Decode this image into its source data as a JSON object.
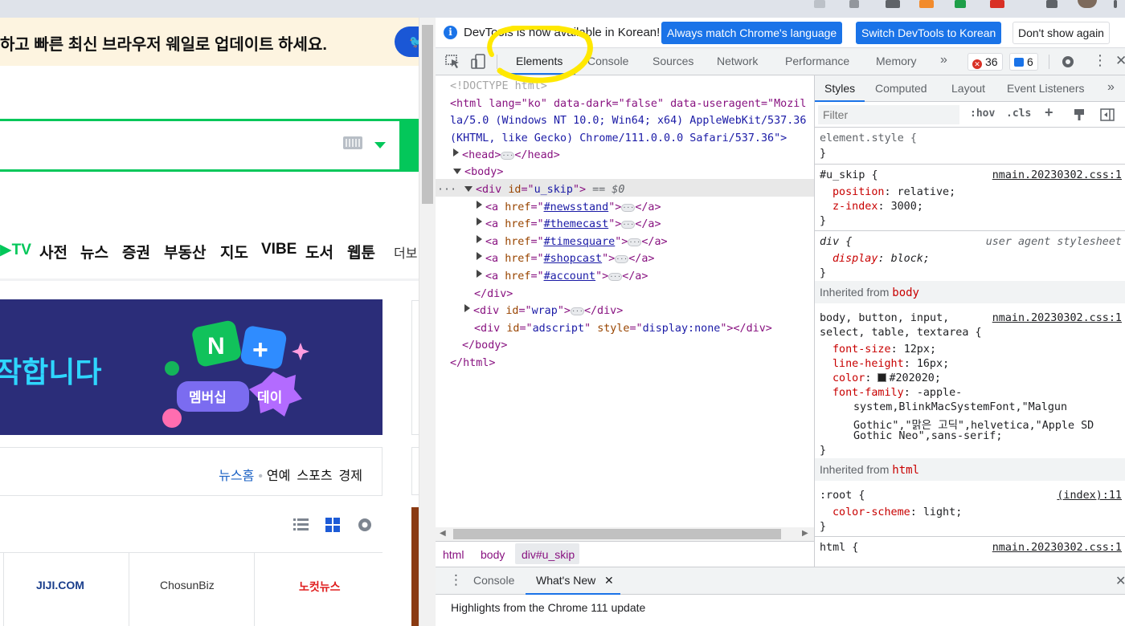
{
  "page": {
    "banner_text": "하고 빠른 최신 브라우저 웨일로 업데이트 하세요.",
    "services": [
      "TV",
      "사전",
      "뉴스",
      "증권",
      "부동산",
      "지도",
      "VIBE",
      "도서",
      "웹툰"
    ],
    "services_more": "더보",
    "ad_headline": "작합니다",
    "ad_badge1": "멤버십",
    "ad_badge2": "데이",
    "news_tabs": {
      "home": "뉴스홈",
      "t1": "연예",
      "t2": "스포츠",
      "t3": "경제"
    },
    "press": [
      "JIJI.COM",
      "ChosunBiz",
      "노컷뉴스"
    ]
  },
  "devtools": {
    "infobar": {
      "message": "DevTools is now available in Korean!",
      "btn_match": "Always match Chrome's language",
      "btn_switch": "Switch DevTools to Korean",
      "btn_dismiss": "Don't show again"
    },
    "tabs": [
      "Elements",
      "Console",
      "Sources",
      "Network",
      "Performance",
      "Memory"
    ],
    "errors_count": "36",
    "messages_count": "6",
    "dom": {
      "doctype": "<!DOCTYPE html>",
      "html_open_1": "<html lang=\"ko\" data-dark=\"false\" data-useragent=\"Mozil",
      "html_open_2": "la/5.0 (Windows NT 10.0; Win64; x64) AppleWebKit/537.36",
      "html_open_3": "(KHTML, like Gecko) Chrome/111.0.0.0 Safari/537.36\">",
      "head": "head",
      "body": "body",
      "div_id": "u_skip",
      "sel_marker": "== $0",
      "links": [
        "#newsstand",
        "#themecast",
        "#timesquare",
        "#shopcast",
        "#account"
      ],
      "wrap_id": "wrap",
      "adscript_id": "adscript",
      "adscript_style": "display:none"
    },
    "breadcrumbs": [
      "html",
      "body",
      "div#u_skip"
    ],
    "styles": {
      "tabs": [
        "Styles",
        "Computed",
        "Layout",
        "Event Listeners"
      ],
      "filter_placeholder": "Filter",
      "hov": ":hov",
      "cls": ".cls",
      "element_style": "element.style {",
      "rule1_selector": "#u_skip {",
      "rule1_source": "nmain.20230302.css:1",
      "rule1_props": [
        [
          "position",
          "relative"
        ],
        [
          "z-index",
          "3000"
        ]
      ],
      "rule2_selector": "div {",
      "rule2_source": "user agent stylesheet",
      "rule2_props": [
        [
          "display",
          "block"
        ]
      ],
      "inherited_body": "Inherited from",
      "inherited_body_tag": "body",
      "rule3_selector_1": "body, button, input,",
      "rule3_selector_2": "select, table, textarea {",
      "rule3_source": "nmain.20230302.css:1",
      "rule3_fontsize": "12px",
      "rule3_lineheight": "16px",
      "rule3_color": "#202020",
      "rule3_family_1": "-apple-",
      "rule3_family_2": "system,BlinkMacSystemFont,\"Malgun",
      "rule3_family_3": "Gothic\",\"맑은 고딕\",helvetica,\"Apple SD",
      "rule3_family_4": "Gothic Neo\",sans-serif;",
      "inherited_html": "Inherited from",
      "inherited_html_tag": "html",
      "rule4_selector": ":root {",
      "rule4_source": "(index):11",
      "rule4_prop": "color-scheme",
      "rule4_val": "light",
      "rule5_selector": "html {",
      "rule5_source": "nmain.20230302.css:1"
    },
    "drawer": {
      "tabs": [
        "Console",
        "What's New"
      ],
      "highlights": "Highlights from the Chrome 111 update"
    }
  },
  "colors": {
    "accent": "#1a73e8",
    "naver_green": "#03c75a",
    "annotation": "#ffe800"
  }
}
